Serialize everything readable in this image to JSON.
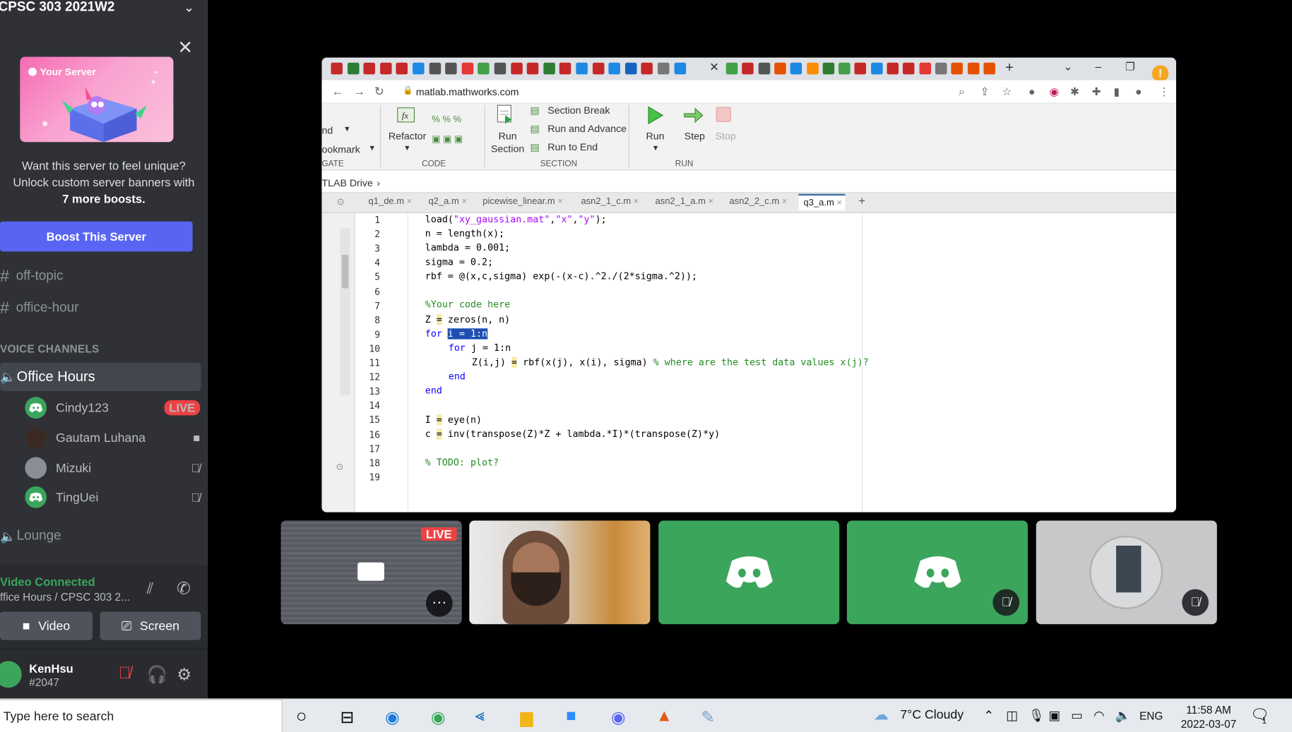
{
  "server": {
    "name": "CPSC 303 2021W2"
  },
  "promo": {
    "banner_label": "Your Server",
    "line1": "Want this server to feel unique?",
    "line2": "Unlock custom server banners with",
    "line3": "7 more boosts.",
    "boost_button": "Boost This Server"
  },
  "channels": [
    {
      "name": "off-topic"
    },
    {
      "name": "office-hour"
    }
  ],
  "voice_category": "VOICE CHANNELS",
  "voice_channel": "Office Hours",
  "voice_users": [
    {
      "name": "Cindy123",
      "badge": "LIVE"
    },
    {
      "name": "Gautam Luhana"
    },
    {
      "name": "Mizuki"
    },
    {
      "name": "TingUei"
    }
  ],
  "lounge": "Lounge",
  "voice_panel": {
    "status": "Video Connected",
    "location": "ffice Hours / CPSC 303 2...",
    "video_button": "Video",
    "screen_button": "Screen"
  },
  "user": {
    "name": "KenHsu",
    "tag": "#2047"
  },
  "browser": {
    "url": "matlab.mathworks.com",
    "ribbon": {
      "nd": "nd",
      "ookmark": "ookmark",
      "gate_group": "GATE",
      "refactor": "Refactor",
      "code_group": "CODE",
      "run_section_1": "Run",
      "run_section_2": "Section",
      "section_break": "Section Break",
      "run_and_advance": "Run and Advance",
      "run_to_end": "Run to End",
      "section_group": "SECTION",
      "run": "Run",
      "step": "Step",
      "stop": "Stop",
      "run_group": "RUN"
    },
    "path": "TLAB Drive",
    "path_chevron": "›",
    "editor_tabs": [
      "q1_de.m",
      "q2_a.m",
      "picewise_linear.m",
      "asn2_1_c.m",
      "asn2_1_a.m",
      "asn2_2_c.m",
      "q3_a.m"
    ],
    "line_numbers": [
      "1",
      "2",
      "3",
      "4",
      "5",
      "6",
      "7",
      "8",
      "9",
      "10",
      "11",
      "12",
      "13",
      "14",
      "15",
      "16",
      "17",
      "18",
      "19"
    ]
  },
  "code": {
    "l1a": "load(",
    "l1s1": "\"xy_gaussian.mat\"",
    "l1c1": ",",
    "l1s2": "\"x\"",
    "l1c2": ",",
    "l1s3": "\"y\"",
    "l1e": ");",
    "l2": "n = length(x);",
    "l3": "lambda = 0.001;",
    "l4": "sigma = 0.2;",
    "l5": "rbf = @(x,c,sigma) exp(-(x-c).^2./(2*sigma.^2));",
    "l7": "%Your code here",
    "l8a": "Z ",
    "l8eq": "=",
    "l8b": " zeros(n, n)",
    "l9kw": "for",
    "l9sel": "i = 1:n",
    "l10kw": "for",
    "l10b": " j = 1:n",
    "l11a": "Z(i,j) ",
    "l11eq": "=",
    "l11b": " rbf(x(j), x(i), sigma) ",
    "l11cm": "% where are the test data values x(j)?",
    "l12kw": "end",
    "l13kw": "end",
    "l15a": "I ",
    "l15eq": "=",
    "l15b": " eye(n)",
    "l16a": "c ",
    "l16eq": "=",
    "l16b": " inv(transpose(Z)*Z + lambda.*I)*(transpose(Z)*y)",
    "l18": "% TODO: plot?"
  },
  "tiles": {
    "live": "LIVE"
  },
  "taskbar": {
    "search_placeholder": "Type here to search",
    "weather": "7°C  Cloudy",
    "language": "ENG",
    "time": "11:58 AM",
    "date": "2022-03-07",
    "notification_count": "1"
  },
  "colors": {
    "discord_green": "#3ba55c",
    "blurple": "#5865f2",
    "live_red": "#ed4245"
  }
}
